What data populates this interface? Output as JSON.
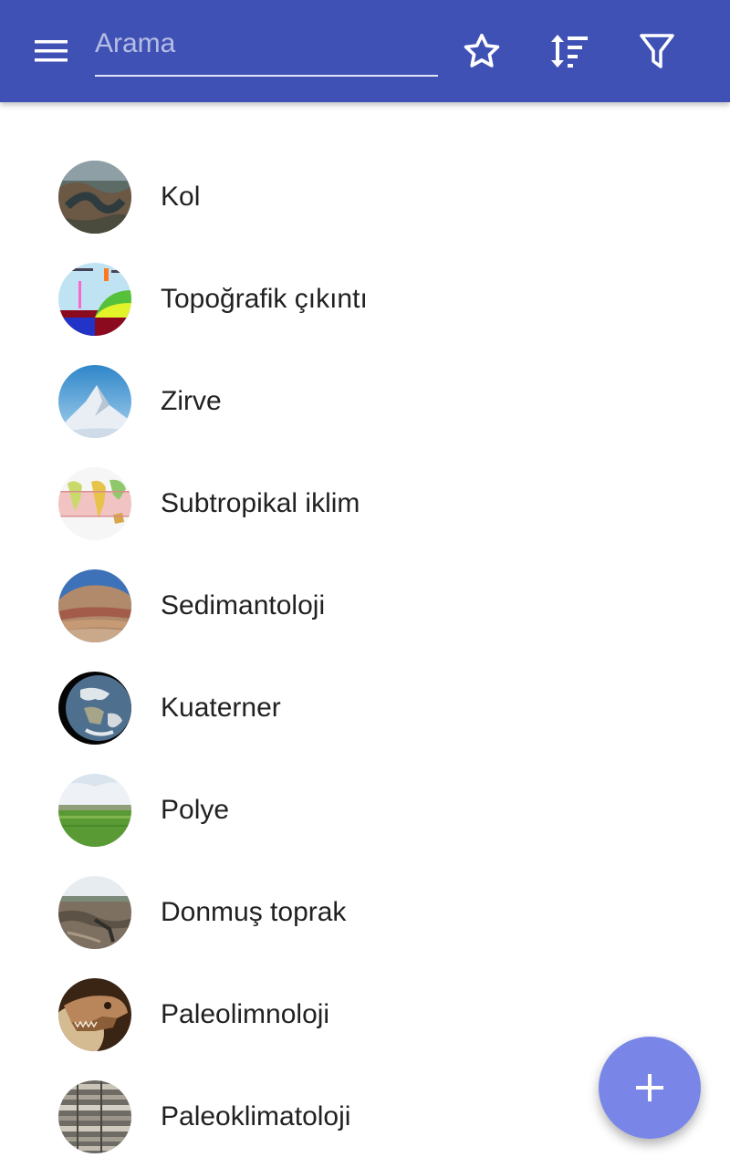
{
  "toolbar": {
    "background": "#3f51b5",
    "menu_icon": "hamburger-menu-icon",
    "search": {
      "placeholder": "Arama",
      "value": ""
    },
    "actions": [
      {
        "icon": "star-outline-icon"
      },
      {
        "icon": "sort-icon"
      },
      {
        "icon": "filter-icon"
      }
    ]
  },
  "list": {
    "items": [
      {
        "label": "Kol"
      },
      {
        "label": "Topoğrafik çıkıntı"
      },
      {
        "label": "Zirve"
      },
      {
        "label": "Subtropikal iklim"
      },
      {
        "label": "Sedimantoloji"
      },
      {
        "label": "Kuaterner"
      },
      {
        "label": "Polye"
      },
      {
        "label": "Donmuş toprak"
      },
      {
        "label": "Paleolimnoloji"
      },
      {
        "label": "Paleoklimatoloji"
      }
    ]
  },
  "fab": {
    "icon": "plus-icon",
    "color": "#7986e8"
  }
}
